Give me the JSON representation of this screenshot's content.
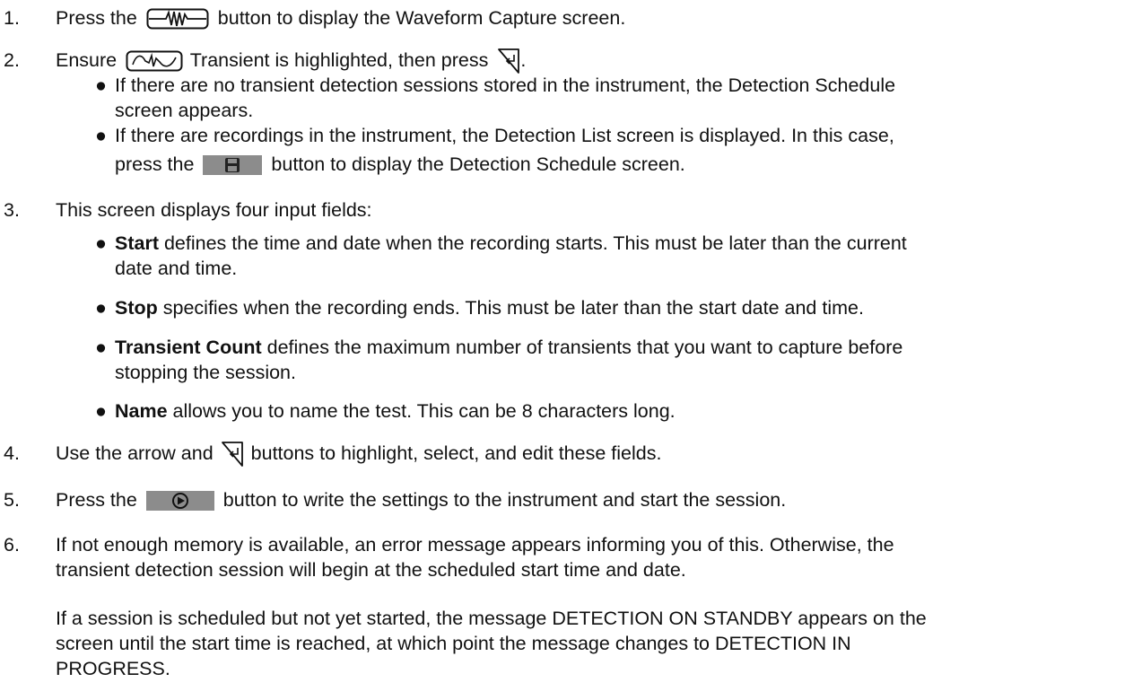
{
  "steps": [
    {
      "num": "1.",
      "pre": "Press the",
      "post": "button to display the Waveform Capture screen."
    },
    {
      "num": "2.",
      "pre": "Ensure",
      "mid": "Transient is highlighted, then press",
      "post": "."
    },
    {
      "num": "3.",
      "text": "This screen displays four input fields:"
    },
    {
      "num": "4.",
      "pre": "Use the arrow and",
      "post": "buttons to highlight, select, and edit these fields."
    },
    {
      "num": "5.",
      "pre": "Press the",
      "post": "button to write the settings to the instrument and start the session."
    },
    {
      "num": "6.",
      "line1": "If not enough memory is available, an error message appears informing you of this. Otherwise, the",
      "line2": "transient detection session will begin at the scheduled start time and date."
    }
  ],
  "step2_bullets": [
    {
      "line1": "If there are no transient detection sessions stored in the instrument, the Detection Schedule",
      "line2": "screen appears."
    },
    {
      "line1": "If there are recordings in the instrument, the Detection List screen is displayed. In this case,",
      "line2_pre": "press the",
      "line2_post": "button to display the Detection Schedule screen."
    }
  ],
  "step3_bullets": [
    {
      "term": "Start",
      "line1": " defines the time and date when the recording starts. This must be later than the current",
      "line2": "date and time."
    },
    {
      "term": "Stop",
      "line1": " specifies when the recording ends. This must be later than the start date and time."
    },
    {
      "term": "Transient Count",
      "line1": " defines the maximum number of transients that you want to capture before",
      "line2": "stopping the session."
    },
    {
      "term": "Name",
      "line1": " allows you to name the test. This can be 8 characters long."
    }
  ],
  "note": {
    "line1": "If a session is scheduled but not yet started, the message DETECTION ON STANDBY appears on the",
    "line2": "screen until the start time is reached, at which point the message changes to DETECTION IN",
    "line3": "PROGRESS."
  },
  "bullet_glyph": "●",
  "icons": {
    "waveform_button": "waveform-capture-icon",
    "transient": "transient-icon",
    "enter": "enter-icon",
    "save": "save-icon",
    "play": "play-icon"
  },
  "colors": {
    "text": "#111111",
    "button_fill": "#8c8c8c"
  }
}
